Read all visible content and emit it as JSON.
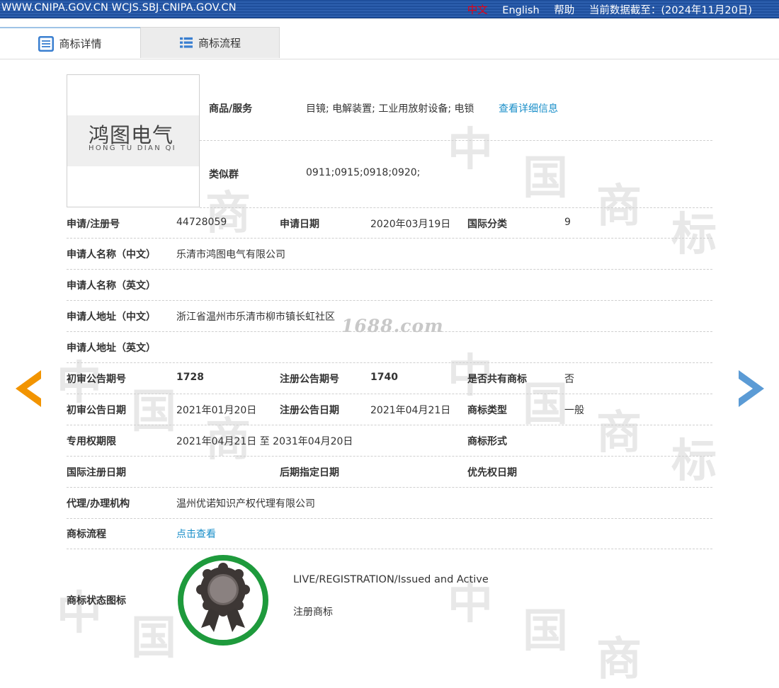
{
  "topbar": {
    "site_url": "WWW.CNIPA.GOV.CN WCJS.SBJ.CNIPA.GOV.CN",
    "lang_zh": "中文",
    "lang_en": "English",
    "help": "帮助",
    "data_cutoff": "当前数据截至：(2024年11月20日)"
  },
  "tabs": [
    {
      "label": "商标详情",
      "active": true
    },
    {
      "label": "商标流程",
      "active": false
    }
  ],
  "logo": {
    "text_cn": "鸿图电气",
    "text_en": "HONG TU DIAN QI"
  },
  "goods": {
    "label": "商品/服务",
    "value": "目镜; 电解装置; 工业用放射设备; 电锁",
    "detail_link": "查看详细信息"
  },
  "similar_group": {
    "label": "类似群",
    "value": "0911;0915;0918;0920;"
  },
  "rows": {
    "reg_no_label": "申请/注册号",
    "reg_no": "44728059",
    "apply_date_label": "申请日期",
    "apply_date": "2020年03月19日",
    "intl_class_label": "国际分类",
    "intl_class": "9",
    "applicant_cn_label": "申请人名称（中文）",
    "applicant_cn": "乐清市鸿图电气有限公司",
    "applicant_en_label": "申请人名称（英文）",
    "applicant_en": "",
    "address_cn_label": "申请人地址（中文）",
    "address_cn": "浙江省温州市乐清市柳市镇长虹社区",
    "address_en_label": "申请人地址（英文）",
    "address_en": "",
    "prelim_no_label": "初审公告期号",
    "prelim_no": "1728",
    "reg_pub_no_label": "注册公告期号",
    "reg_pub_no": "1740",
    "shared_label": "是否共有商标",
    "shared": "否",
    "prelim_date_label": "初审公告日期",
    "prelim_date": "2021年01月20日",
    "reg_pub_date_label": "注册公告日期",
    "reg_pub_date": "2021年04月21日",
    "tm_type_label": "商标类型",
    "tm_type": "一般",
    "term_label": "专用权期限",
    "term": "2021年04月21日 至 2031年04月20日",
    "tm_form_label": "商标形式",
    "tm_form": "",
    "intl_reg_date_label": "国际注册日期",
    "later_designation_label": "后期指定日期",
    "priority_date_label": "优先权日期",
    "agent_label": "代理/办理机构",
    "agent": "温州优诺知识产权代理有限公司",
    "flow_label": "商标流程",
    "flow_link": "点击查看",
    "status_icon_label": "商标状态图标",
    "status_en": "LIVE/REGISTRATION/Issued and Active",
    "status_cn": "注册商标"
  },
  "watermark": "1688.com",
  "colors": {
    "topbar": "#2d5fae",
    "link": "#1a8fc9",
    "prev_arrow": "#f29400",
    "next_arrow": "#5b9bd5",
    "badge_ring": "#1e9a3c"
  },
  "icons": {
    "tab_detail": "list-detail-icon",
    "tab_flow": "list-flow-icon",
    "prev": "arrow-left-icon",
    "next": "arrow-right-icon",
    "status": "rosette-award-icon"
  }
}
